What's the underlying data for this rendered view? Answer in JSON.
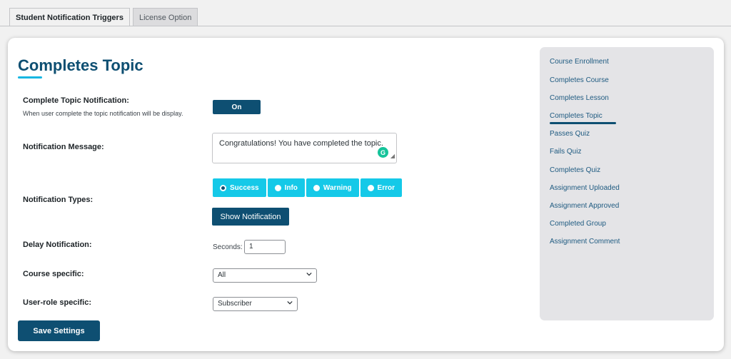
{
  "tabs": [
    {
      "label": "Student Notification Triggers"
    },
    {
      "label": "License Option"
    }
  ],
  "main": {
    "title": "Completes Topic",
    "complete_topic_label": "Complete Topic Notification:",
    "complete_topic_desc": "When user complete the topic notification will be display.",
    "toggle_label": "On",
    "message_label": "Notification Message:",
    "message_value": "Congratulations! You have completed the topic.",
    "types_label": "Notification Types:",
    "types": [
      {
        "label": "Success",
        "checked": true
      },
      {
        "label": "Info",
        "checked": false
      },
      {
        "label": "Warning",
        "checked": false
      },
      {
        "label": "Error",
        "checked": false
      }
    ],
    "show_button": "Show Notification",
    "delay_label": "Delay Notification:",
    "seconds_label": "Seconds:",
    "seconds_value": "1",
    "course_label": "Course specific:",
    "course_value": "All",
    "role_label": "User-role specific:",
    "role_value": "Subscriber",
    "save_button": "Save Settings"
  },
  "sidebar": {
    "items": [
      {
        "label": "Course Enrollment"
      },
      {
        "label": "Completes Course"
      },
      {
        "label": "Completes Lesson"
      },
      {
        "label": "Completes Topic",
        "active": true
      },
      {
        "label": "Passes Quiz"
      },
      {
        "label": "Fails Quiz"
      },
      {
        "label": "Completes Quiz"
      },
      {
        "label": "Assignment Uploaded"
      },
      {
        "label": "Assignment Approved"
      },
      {
        "label": "Completed Group"
      },
      {
        "label": "Assignment Comment"
      }
    ]
  },
  "colors": {
    "primary": "#0e4f72",
    "accent": "#15c9e8",
    "sidebar_bg": "#e4e4e7"
  }
}
